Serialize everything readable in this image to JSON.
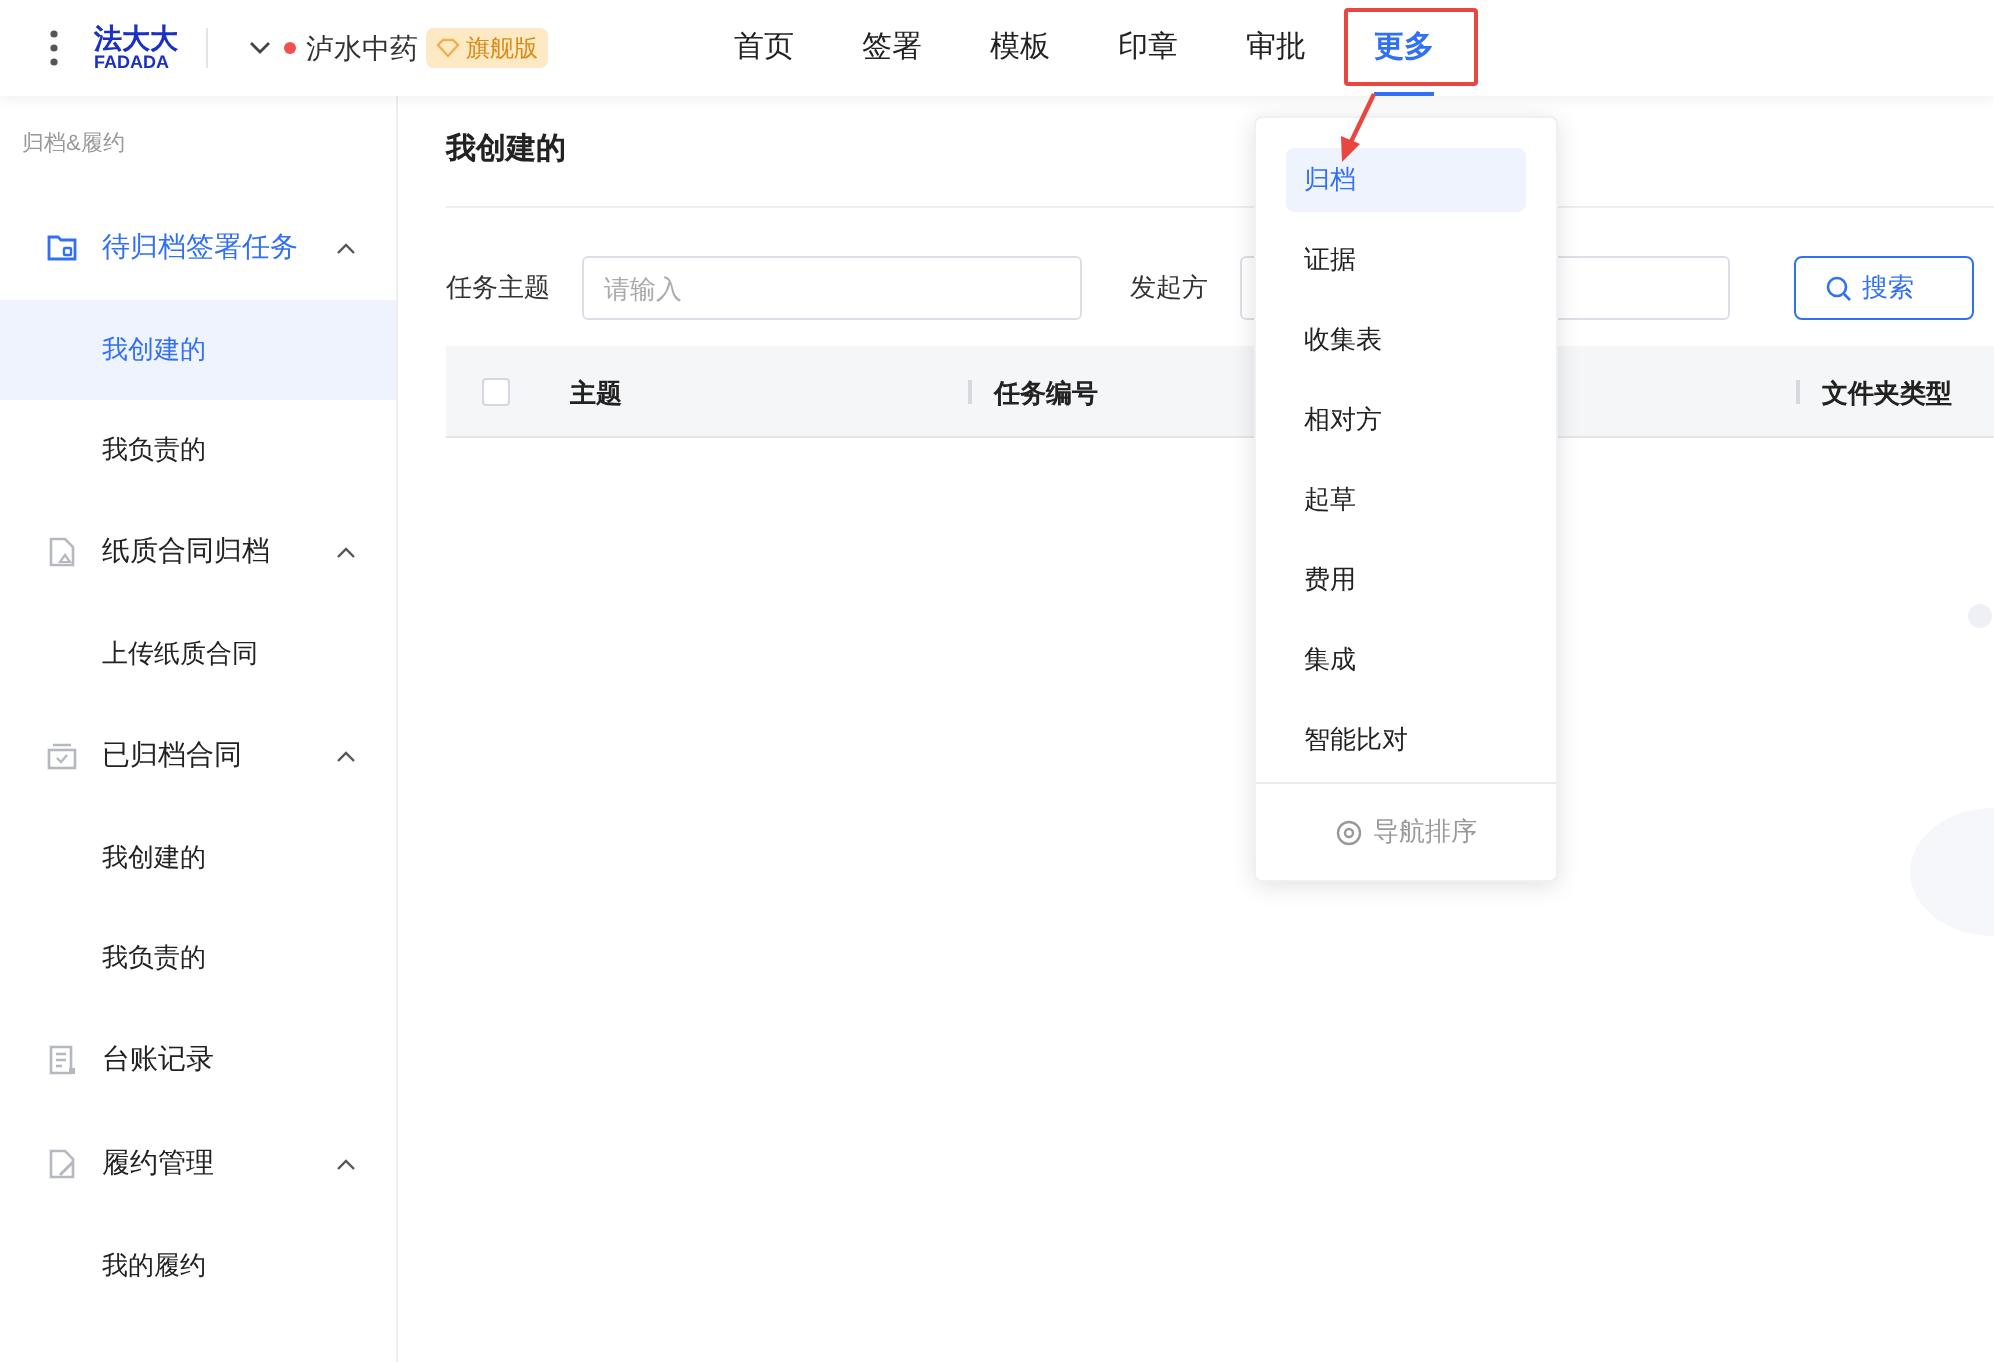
{
  "header": {
    "logo": {
      "mark": "法大大",
      "wordmark": "FADADA"
    },
    "company": {
      "name": "泸水中药",
      "badge": "旗舰版"
    },
    "nav": [
      {
        "label": "首页",
        "selected": false
      },
      {
        "label": "签署",
        "selected": false
      },
      {
        "label": "模板",
        "selected": false
      },
      {
        "label": "印章",
        "selected": false
      },
      {
        "label": "审批",
        "selected": false
      },
      {
        "label": "更多",
        "selected": true
      }
    ]
  },
  "sidebar": {
    "section": "归档&履约",
    "items": [
      {
        "kind": "group",
        "label": "待归档签署任务",
        "active": true,
        "expanded": true,
        "children": [
          {
            "label": "我创建的",
            "selected": true
          },
          {
            "label": "我负责的",
            "selected": false
          }
        ]
      },
      {
        "kind": "group",
        "label": "纸质合同归档",
        "active": false,
        "expanded": true,
        "children": [
          {
            "label": "上传纸质合同",
            "selected": false
          }
        ]
      },
      {
        "kind": "group",
        "label": "已归档合同",
        "active": false,
        "expanded": true,
        "children": [
          {
            "label": "我创建的",
            "selected": false
          },
          {
            "label": "我负责的",
            "selected": false
          }
        ]
      },
      {
        "kind": "item",
        "label": "台账记录",
        "active": false
      },
      {
        "kind": "group",
        "label": "履约管理",
        "active": false,
        "expanded": true,
        "children": [
          {
            "label": "我的履约",
            "selected": false
          }
        ]
      }
    ]
  },
  "content": {
    "title": "我创建的",
    "filters": [
      {
        "label": "任务主题",
        "placeholder": "请输入"
      },
      {
        "label": "发起方"
      }
    ],
    "search_button": "搜索",
    "table": {
      "select_all_checked": false,
      "columns": [
        "主题",
        "任务编号",
        "文件夹类型"
      ]
    }
  },
  "dropdown": {
    "items": [
      {
        "label": "归档",
        "selected": true
      },
      {
        "label": "证据",
        "selected": false
      },
      {
        "label": "收集表",
        "selected": false
      },
      {
        "label": "相对方",
        "selected": false
      },
      {
        "label": "起草",
        "selected": false
      },
      {
        "label": "费用",
        "selected": false
      },
      {
        "label": "集成",
        "selected": false
      },
      {
        "label": "智能比对",
        "selected": false
      }
    ],
    "footer": "导航排序"
  }
}
